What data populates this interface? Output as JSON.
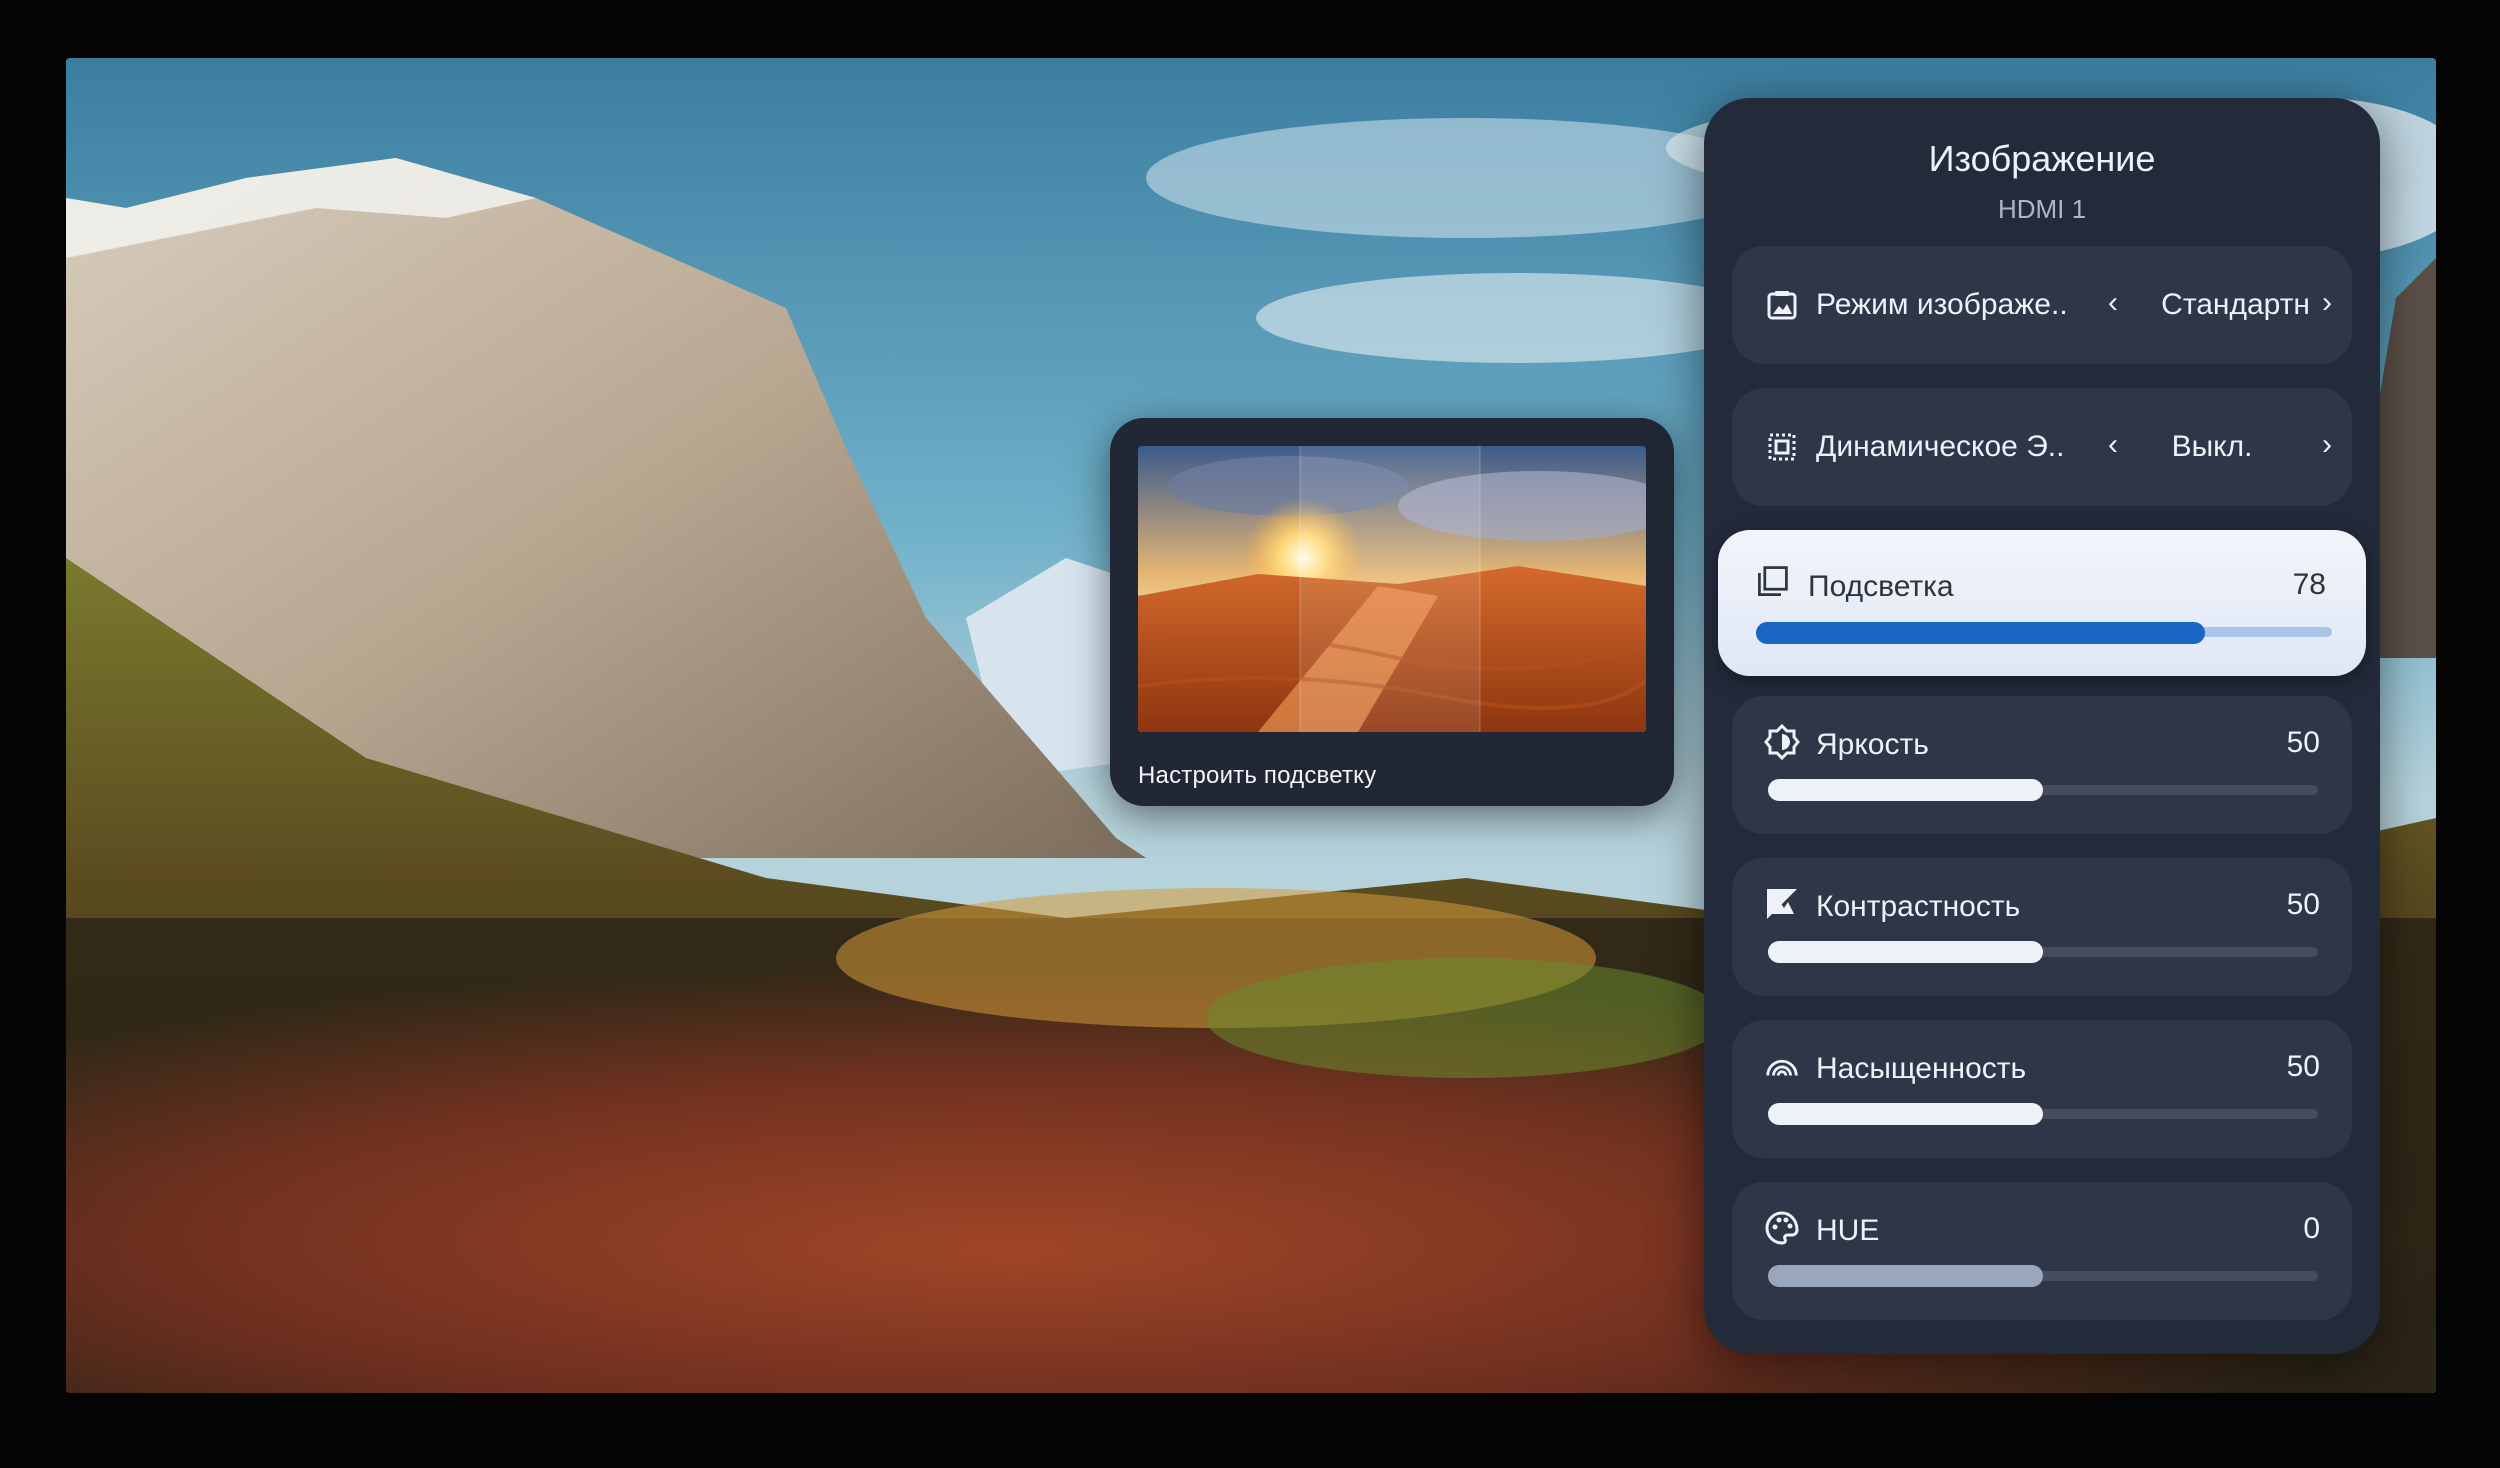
{
  "panel": {
    "title": "Изображение",
    "subtitle": "HDMI 1",
    "items": [
      {
        "label": "Режим изображе..",
        "value": "Стандартн",
        "icon": "picture-mode-icon"
      },
      {
        "label": "Динамическое Э..",
        "value": "Выкл.",
        "icon": "dynamic-effect-icon"
      },
      {
        "label": "Подсветка",
        "value": "78",
        "level": 78,
        "icon": "backlight-icon"
      },
      {
        "label": "Яркость",
        "value": "50",
        "level": 50,
        "icon": "brightness-icon"
      },
      {
        "label": "Контрастность",
        "value": "50",
        "level": 50,
        "icon": "contrast-icon"
      },
      {
        "label": "Насыщенность",
        "value": "50",
        "level": 50,
        "icon": "saturation-icon"
      },
      {
        "label": "HUE",
        "value": "0",
        "level": 50,
        "icon": "palette-icon"
      }
    ]
  },
  "preview": {
    "label": "Настроить подсветку"
  },
  "colors": {
    "panel_bg": "#232a3a",
    "item_bg": "#2f3647",
    "selected_bg": "#eef2f9",
    "accent": "#1866c2"
  }
}
